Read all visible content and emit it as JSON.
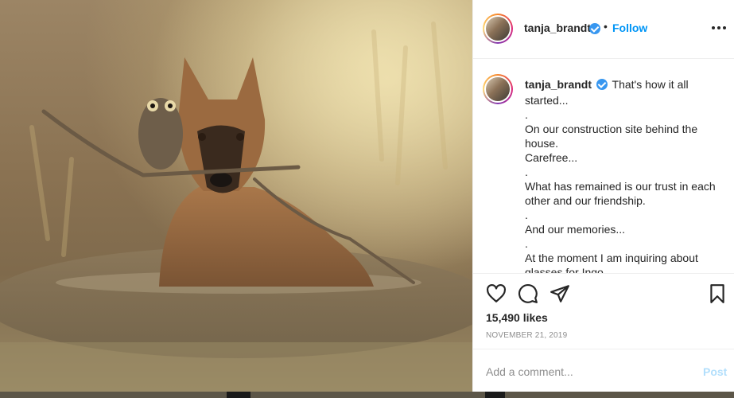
{
  "post": {
    "username": "tanja_brandt",
    "follow_label": "Follow",
    "separator": "•",
    "more_icon": "more-options-icon"
  },
  "caption": {
    "username": "tanja_brandt",
    "lines": [
      "That's how it all started...",
      ".",
      "On our construction site behind the house.",
      "Carefree...",
      ".",
      "What has remained is our trust in each other and our friendship.",
      ".",
      "And our memories...",
      ".",
      "At the moment I am inquiring about glasses for Ingo."
    ]
  },
  "actions": {
    "like_icon": "heart-icon",
    "comment_icon": "comment-icon",
    "share_icon": "share-icon",
    "save_icon": "bookmark-icon",
    "likes": "15,490 likes",
    "date": "NOVEMBER 21, 2019"
  },
  "comment": {
    "placeholder": "Add a comment...",
    "post_label": "Post"
  },
  "colors": {
    "link_blue": "#0095f6",
    "verified_blue": "#3897f0",
    "post_disabled": "#b2dffc",
    "muted": "#8e8e8e"
  }
}
